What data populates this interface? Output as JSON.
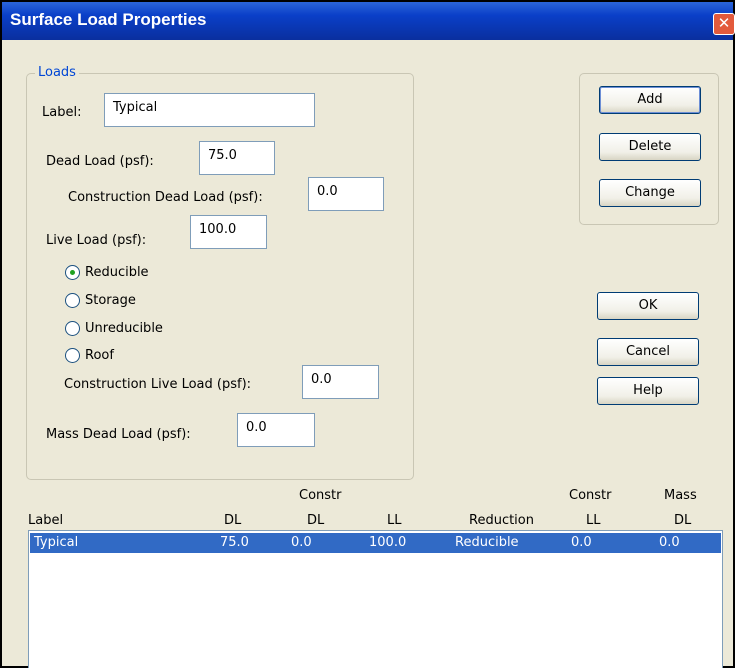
{
  "window": {
    "title": "Surface Load Properties",
    "close_glyph": "✕"
  },
  "loads": {
    "legend": "Loads",
    "label": {
      "label": "Label:",
      "value": "Typical"
    },
    "dead_load": {
      "label": "Dead Load (psf):",
      "value": "75.0"
    },
    "construction_dead_load": {
      "label": "Construction Dead Load (psf):",
      "value": "0.0"
    },
    "live_load": {
      "label": "Live Load (psf):",
      "value": "100.0"
    },
    "live_load_type": {
      "options": [
        "Reducible",
        "Storage",
        "Unreducible",
        "Roof"
      ],
      "selected": "Reducible"
    },
    "construction_live_load": {
      "label": "Construction Live Load (psf):",
      "value": "0.0"
    },
    "mass_dead_load": {
      "label": "Mass Dead Load (psf):",
      "value": "0.0"
    }
  },
  "buttons": {
    "add": "Add",
    "delete": "Delete",
    "change": "Change",
    "ok": "OK",
    "cancel": "Cancel",
    "help": "Help"
  },
  "table": {
    "columns": [
      {
        "line1": "",
        "line2": "Label"
      },
      {
        "line1": "",
        "line2": "DL"
      },
      {
        "line1": "Constr",
        "line2": "DL"
      },
      {
        "line1": "",
        "line2": "LL"
      },
      {
        "line1": "",
        "line2": "Reduction"
      },
      {
        "line1": "Constr",
        "line2": "LL"
      },
      {
        "line1": "Mass",
        "line2": "DL"
      }
    ],
    "rows": [
      {
        "label": "Typical",
        "dl": "75.0",
        "constr_dl": "0.0",
        "ll": "100.0",
        "reduction": "Reducible",
        "constr_ll": "0.0",
        "mass_dl": "0.0",
        "selected": true
      }
    ]
  },
  "colors": {
    "titlebar": "#0a3fc8",
    "selection": "#316ac5",
    "group_legend": "#0046d5"
  }
}
